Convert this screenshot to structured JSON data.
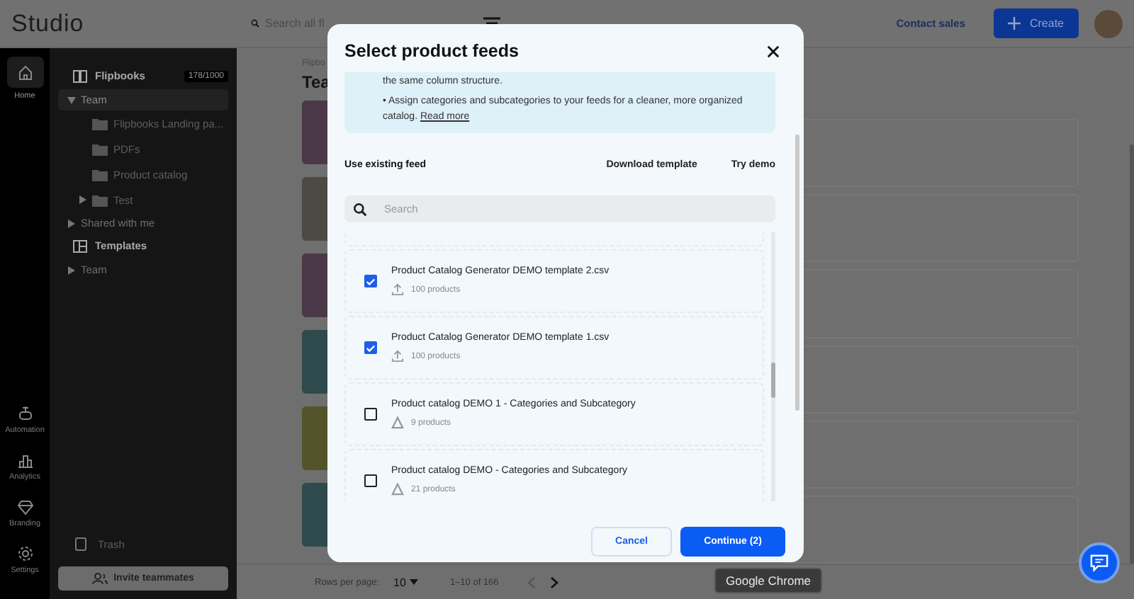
{
  "topbar": {
    "logo": "Studio",
    "search_placeholder": "Search all fl",
    "contact": "Contact sales",
    "create": "Create"
  },
  "rail": [
    {
      "label": "Home",
      "kind": "home",
      "selected": true
    },
    {
      "label": "Automation",
      "kind": "robot",
      "selected": false
    },
    {
      "label": "Analytics",
      "kind": "chart",
      "selected": false
    },
    {
      "label": "Branding",
      "kind": "diamond",
      "selected": false
    },
    {
      "label": "Settings",
      "kind": "gear",
      "selected": false
    }
  ],
  "sidebar": {
    "sections": [
      {
        "label": "Flipbooks",
        "kind": "book",
        "badge": "178/1000",
        "children": [
          {
            "label": "Team",
            "expanded": true,
            "selected": true,
            "children": [
              {
                "label": "Flipbooks Landing pa..."
              },
              {
                "label": "PDFs"
              },
              {
                "label": "Product catalog"
              },
              {
                "label": "Test",
                "expanded": false
              }
            ]
          },
          {
            "label": "Shared with me",
            "expanded": false,
            "selected": false
          }
        ]
      },
      {
        "label": "Templates",
        "kind": "template",
        "children": [
          {
            "label": "Team",
            "expanded": false,
            "selected": false
          }
        ]
      }
    ],
    "trash": "Trash",
    "invite": "Invite teammates"
  },
  "main": {
    "breadcrumb": "Flipbo",
    "title": "Tea",
    "pagination": {
      "rows_label": "Rows per page:",
      "rows_value": "10",
      "range": "1–10 of 166"
    }
  },
  "dialog": {
    "title": "Select product feeds",
    "info": {
      "line": "the same column structure.",
      "bullet": "• Assign categories and subcategories to your feeds for a cleaner, more organized catalog.",
      "link": "Read more"
    },
    "section_label": "Use existing feed",
    "actions": [
      "Download template",
      "Try demo"
    ],
    "search_placeholder": "Search",
    "feeds": [
      {
        "name": "Product Catalog Generator DEMO template 2.csv",
        "count": "100 products",
        "kind": "upload",
        "checked": true
      },
      {
        "name": "Product Catalog Generator DEMO template 1.csv",
        "count": "100 products",
        "kind": "upload",
        "checked": true
      },
      {
        "name": "Product catalog DEMO 1 - Categories and Subcategory",
        "count": "9 products",
        "kind": "shared",
        "checked": false
      },
      {
        "name": "Product catalog DEMO - Categories and Subcategory",
        "count": "21 products",
        "kind": "shared",
        "checked": false
      }
    ],
    "cancel": "Cancel",
    "confirm": "Continue (2)"
  },
  "tooltip": "Google Chrome"
}
